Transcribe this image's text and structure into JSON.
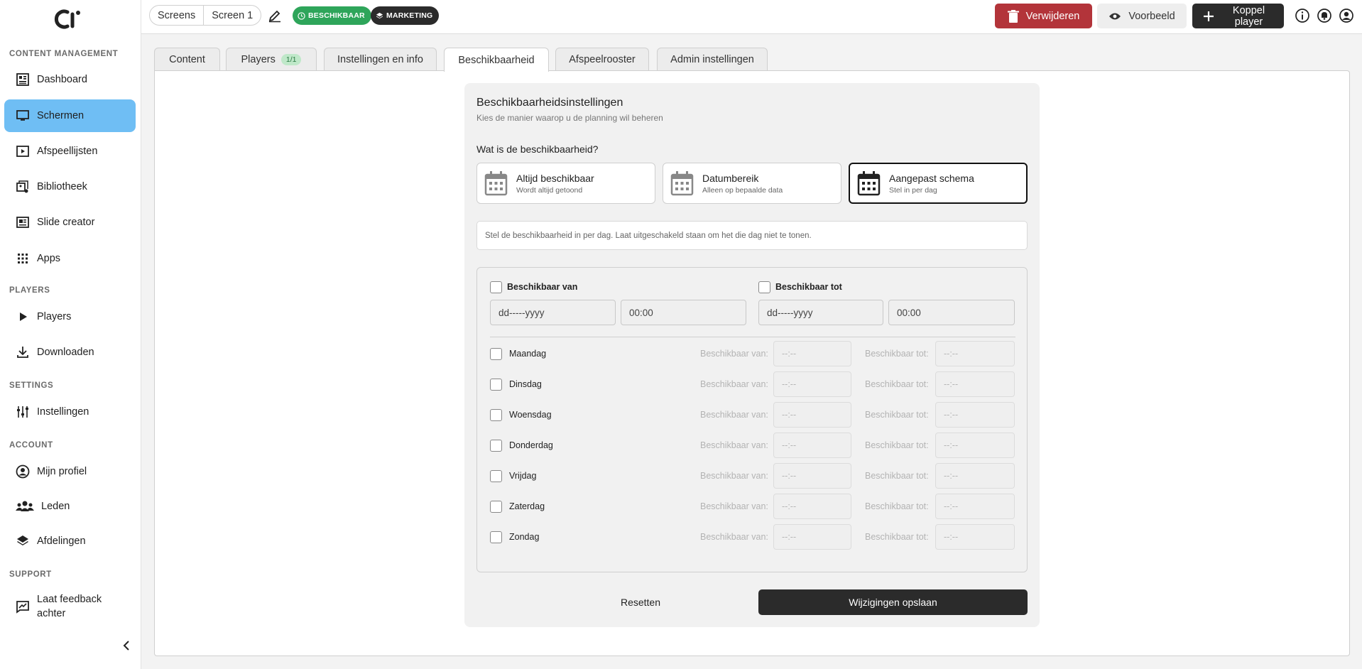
{
  "sidebar": {
    "sections": [
      "CONTENT MANAGEMENT",
      "PLAYERS",
      "SETTINGS",
      "ACCOUNT",
      "SUPPORT"
    ],
    "items": [
      {
        "label": "Dashboard",
        "icon": "dashboard-icon"
      },
      {
        "label": "Schermen",
        "icon": "monitor-icon",
        "active": true
      },
      {
        "label": "Afspeellijsten",
        "icon": "playlist-icon"
      },
      {
        "label": "Bibliotheek",
        "icon": "library-icon"
      },
      {
        "label": "Slide creator",
        "icon": "slide-creator-icon"
      },
      {
        "label": "Apps",
        "icon": "apps-grid-icon"
      },
      {
        "label": "Players",
        "icon": "play-icon"
      },
      {
        "label": "Downloaden",
        "icon": "download-icon"
      },
      {
        "label": "Instellingen",
        "icon": "sliders-icon"
      },
      {
        "label": "Mijn profiel",
        "icon": "profile-icon"
      },
      {
        "label": "Leden",
        "icon": "members-icon"
      },
      {
        "label": "Afdelingen",
        "icon": "layers-icon"
      },
      {
        "label": "Laat feedback achter",
        "icon": "feedback-icon"
      }
    ]
  },
  "header": {
    "breadcrumbs": [
      "Screens",
      "Screen 1"
    ],
    "badge_available": "BESCHIKBAAR",
    "badge_department": "MARKETING",
    "delete_label": "Verwijderen",
    "preview_label": "Voorbeeld",
    "link_player_label": "Koppel player"
  },
  "tabs": [
    {
      "label": "Content"
    },
    {
      "label": "Players",
      "count": "1/1"
    },
    {
      "label": "Instellingen en info"
    },
    {
      "label": "Beschikbaarheid",
      "active": true
    },
    {
      "label": "Afspeelrooster"
    },
    {
      "label": "Admin instellingen"
    }
  ],
  "availability": {
    "title": "Beschikbaarheidsinstellingen",
    "subtitle": "Kies de manier waarop u de planning wil beheren",
    "question": "Wat is de beschikbaarheid?",
    "options": [
      {
        "title": "Altijd beschikbaar",
        "subtitle": "Wordt altijd getoond"
      },
      {
        "title": "Datumbereik",
        "subtitle": "Alleen op bepaalde data"
      },
      {
        "title": "Aangepast schema",
        "subtitle": "Stel in per dag",
        "selected": true
      }
    ],
    "info": "Stel de beschikbaarheid in per dag. Laat uitgeschakeld staan om het die dag niet te tonen.",
    "from_label": "Beschikbaar van",
    "to_label": "Beschikbaar tot",
    "date_placeholder": "dd-----yyyy",
    "time_value": "00:00",
    "day_from_label": "Beschikbaar van:",
    "day_to_label": "Beschikbaar tot:",
    "day_time_placeholder": "--:--",
    "days": [
      "Maandag",
      "Dinsdag",
      "Woensdag",
      "Donderdag",
      "Vrijdag",
      "Zaterdag",
      "Zondag"
    ],
    "reset_label": "Resetten",
    "save_label": "Wijzigingen opslaan"
  }
}
